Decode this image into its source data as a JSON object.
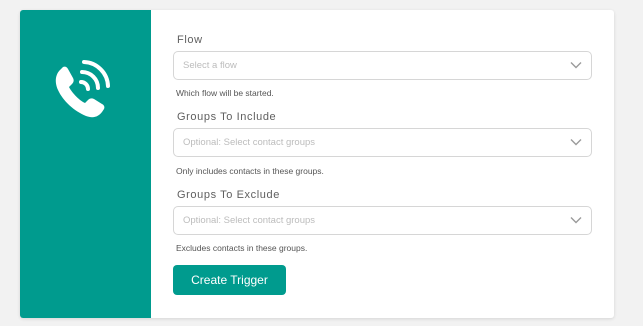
{
  "colors": {
    "accent": "#009b8e"
  },
  "sidebar": {
    "icon": "phone-ringing-icon"
  },
  "form": {
    "flow": {
      "label": "Flow",
      "placeholder": "Select a flow",
      "help": "Which flow will be started."
    },
    "groups_include": {
      "label": "Groups To Include",
      "placeholder": "Optional: Select contact groups",
      "help": "Only includes contacts in these groups."
    },
    "groups_exclude": {
      "label": "Groups To Exclude",
      "placeholder": "Optional: Select contact groups",
      "help": "Excludes contacts in these groups."
    },
    "submit_label": "Create Trigger"
  }
}
